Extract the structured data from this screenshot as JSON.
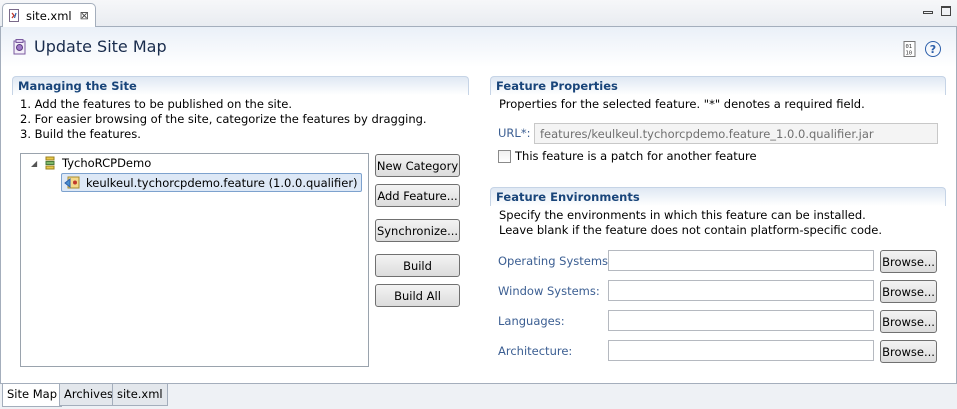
{
  "editor_tab": {
    "title": "site.xml",
    "close": "⊠"
  },
  "header": {
    "title": "Update Site Map",
    "help": "?"
  },
  "managing": {
    "title": "Managing the Site",
    "instructions": [
      "1. Add the features to be published on the site.",
      "2. For easier browsing of the site, categorize the features by dragging.",
      "3. Build the features."
    ],
    "tree": {
      "category": "TychoRCPDemo",
      "feature": "keulkeul.tychorcpdemo.feature (1.0.0.qualifier)"
    },
    "buttons": {
      "new_category": "New Category",
      "add_feature": "Add Feature...",
      "synchronize": "Synchronize...",
      "build": "Build",
      "build_all": "Build All"
    }
  },
  "feature_properties": {
    "title": "Feature Properties",
    "description": "Properties for the selected feature.  \"*\" denotes a required field.",
    "url_label": "URL*:",
    "url_value": "features/keulkeul.tychorcpdemo.feature_1.0.0.qualifier.jar",
    "patch_label": "This feature is a patch for another feature",
    "patch_checked": false
  },
  "feature_environments": {
    "title": "Feature Environments",
    "description_1": "Specify the environments in which this feature can be installed.",
    "description_2": "Leave blank if the feature does not contain platform-specific code.",
    "rows": [
      {
        "label": "Operating Systems:",
        "value": "",
        "button": "Browse..."
      },
      {
        "label": "Window Systems:",
        "value": "",
        "button": "Browse..."
      },
      {
        "label": "Languages:",
        "value": "",
        "button": "Browse..."
      },
      {
        "label": "Architecture:",
        "value": "",
        "button": "Browse..."
      }
    ]
  },
  "page_tabs": [
    {
      "label": "Site Map",
      "active": true
    },
    {
      "label": "Archives",
      "active": false
    },
    {
      "label": "site.xml",
      "active": false
    }
  ],
  "colors": {
    "section_title": "#19457a",
    "label_blue": "#3b5e92",
    "header_title": "#192c4d"
  },
  "icons": [
    "xml-file-icon",
    "close-icon",
    "minimize-icon",
    "maximize-icon",
    "update-site-icon",
    "binary-icon",
    "help-icon",
    "category-icon",
    "feature-icon",
    "tree-expand-icon"
  ]
}
